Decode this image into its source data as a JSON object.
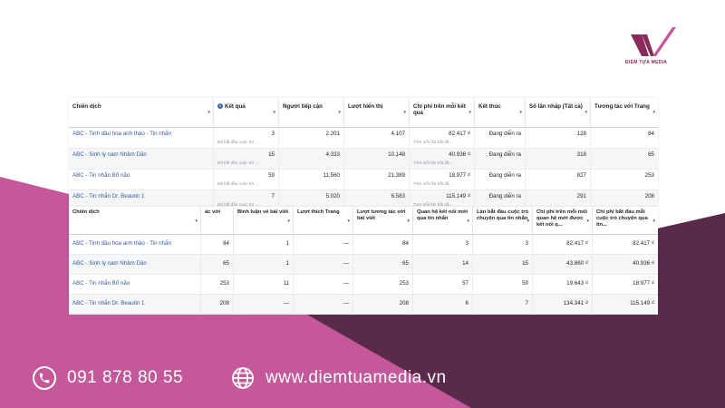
{
  "brand": {
    "name": "ĐIỂM TỰA MEDIA",
    "accent": "#c4589a",
    "dark": "#5a2a4a"
  },
  "table1": {
    "headers": [
      "Chiến dịch",
      "Kết quả",
      "Người tiếp cận",
      "Lượt hiển thị",
      "Chi phí trên mỗi kết quả",
      "Kết thúc",
      "Số lần nhấp (Tất cả)",
      "Tương tác với Trang"
    ],
    "rows": [
      {
        "name": "ABC - Tinh dầu hoa anh thảo - Tin nhắn",
        "result": "3",
        "result_sub": "Đã bắt đầu cuộc trò ...",
        "reach": "2.201",
        "impressions": "4.107",
        "cpr": "82.417 ₫",
        "cpr_sub": "Trên mỗi lần bắt đầ...",
        "end": "Đang diễn ra",
        "clicks": "128",
        "engagement": "84"
      },
      {
        "name": "ABC - Sinh lý nam Nhâm Dần",
        "result": "15",
        "result_sub": "Đã bắt đầu cuộc trò ...",
        "reach": "4.333",
        "impressions": "10.148",
        "cpr": "40.936 ₫",
        "cpr_sub": "Trên mỗi lần bắt đầ...",
        "end": "Đang diễn ra",
        "clicks": "318",
        "engagement": "65"
      },
      {
        "name": "ABC - Tin nhắn Bổ não",
        "result": "59",
        "result_sub": "Đã bắt đầu cuộc trò ...",
        "reach": "11.560",
        "impressions": "21.389",
        "cpr": "18.977 ₫",
        "cpr_sub": "Trên mỗi lần bắt đầ...",
        "end": "Đang diễn ra",
        "clicks": "827",
        "engagement": "253"
      },
      {
        "name": "ABC - Tin nhắn Dr. Beautin 1",
        "result": "7",
        "result_sub": "Đã bắt đầu cuộc trò ...",
        "reach": "5.020",
        "impressions": "6.583",
        "cpr": "115.149 ₫",
        "cpr_sub": "Trên mỗi lần bắt đầ...",
        "end": "Đang diễn ra",
        "clicks": "291",
        "engagement": "208"
      }
    ]
  },
  "table2": {
    "headers": [
      "Chiến dịch",
      "ác với",
      "Bình luận về bài viết",
      "Lượt thích Trang",
      "Lượt tương tác với bài viết",
      "Quan hệ kết nối mới qua tin nhắn",
      "Lần bắt đầu cuộc trò chuyện qua tin nhắn",
      "Chi phí trên mỗi mối quan hệ mới được kết nối q...",
      "Chi phí bắt đầu mỗi cuộc trò chuyện qua tin..."
    ],
    "rows": [
      {
        "name": "ABC - Tinh dầu hoa anh thảo - Tin nhắn",
        "v1": "84",
        "v2": "1",
        "v3": "—",
        "v4": "84",
        "v5": "3",
        "v6": "3",
        "v7": "82.417 ₫",
        "v8": "82.417 ₫"
      },
      {
        "name": "ABC - Sinh lý nam Nhâm Dần",
        "v1": "65",
        "v2": "1",
        "v3": "—",
        "v4": "65",
        "v5": "14",
        "v6": "15",
        "v7": "43.860 ₫",
        "v8": "40.936 ₫"
      },
      {
        "name": "ABC - Tin nhắn Bổ não",
        "v1": "253",
        "v2": "11",
        "v3": "—",
        "v4": "253",
        "v5": "57",
        "v6": "59",
        "v7": "19.643 ₫",
        "v8": "18.977 ₫"
      },
      {
        "name": "ABC - Tin nhắn Dr. Beautin 1",
        "v1": "208",
        "v2": "—",
        "v3": "—",
        "v4": "208",
        "v5": "6",
        "v6": "7",
        "v7": "134.341 ₫",
        "v8": "115.149 ₫"
      }
    ]
  },
  "contact": {
    "phone": "091 878 80 55",
    "website": "www.diemtuamedia.vn",
    "phone_icon": "phone-icon",
    "web_icon": "globe-icon"
  }
}
